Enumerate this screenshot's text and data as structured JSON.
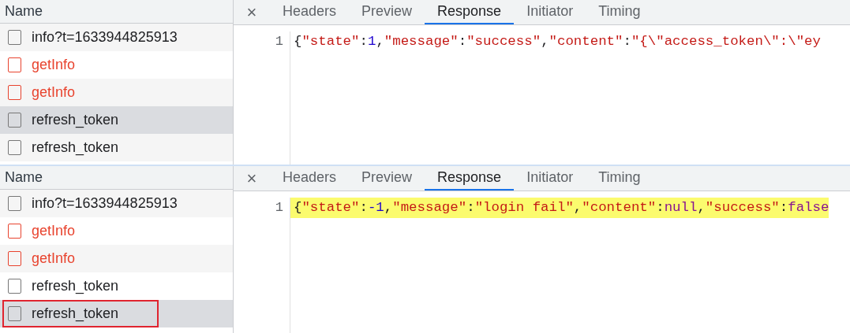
{
  "panels": [
    {
      "requests": {
        "column": "Name",
        "rows": [
          {
            "name": "info?t=1633944825913",
            "kind": "ok",
            "selected": false,
            "outlined": false
          },
          {
            "name": "getInfo",
            "kind": "error",
            "selected": false,
            "outlined": false
          },
          {
            "name": "getInfo",
            "kind": "error",
            "selected": false,
            "outlined": false
          },
          {
            "name": "refresh_token",
            "kind": "ok",
            "selected": true,
            "outlined": false
          },
          {
            "name": "refresh_token",
            "kind": "ok",
            "selected": false,
            "outlined": false
          }
        ]
      },
      "close": "×",
      "tabs": [
        {
          "label": "Headers",
          "selected": false
        },
        {
          "label": "Preview",
          "selected": false
        },
        {
          "label": "Response",
          "selected": true
        },
        {
          "label": "Initiator",
          "selected": false
        },
        {
          "label": "Timing",
          "selected": false
        }
      ],
      "response": {
        "line_number": "1",
        "highlighted": false,
        "tokens": [
          {
            "kind": "punct",
            "text": "{"
          },
          {
            "kind": "string",
            "text": "\"state\""
          },
          {
            "kind": "punct",
            "text": ":"
          },
          {
            "kind": "number",
            "text": "1"
          },
          {
            "kind": "punct",
            "text": ","
          },
          {
            "kind": "string",
            "text": "\"message\""
          },
          {
            "kind": "punct",
            "text": ":"
          },
          {
            "kind": "string",
            "text": "\"success\""
          },
          {
            "kind": "punct",
            "text": ","
          },
          {
            "kind": "string",
            "text": "\"content\""
          },
          {
            "kind": "punct",
            "text": ":"
          },
          {
            "kind": "string",
            "text": "\"{\\\"access_token\\\":\\\"ey"
          }
        ]
      }
    },
    {
      "requests": {
        "column": "Name",
        "rows": [
          {
            "name": "info?t=1633944825913",
            "kind": "ok",
            "selected": false,
            "outlined": false
          },
          {
            "name": "getInfo",
            "kind": "error",
            "selected": false,
            "outlined": false
          },
          {
            "name": "getInfo",
            "kind": "error",
            "selected": false,
            "outlined": false
          },
          {
            "name": "refresh_token",
            "kind": "ok",
            "selected": false,
            "outlined": false
          },
          {
            "name": "refresh_token",
            "kind": "ok",
            "selected": true,
            "outlined": true
          }
        ]
      },
      "close": "×",
      "tabs": [
        {
          "label": "Headers",
          "selected": false
        },
        {
          "label": "Preview",
          "selected": false
        },
        {
          "label": "Response",
          "selected": true
        },
        {
          "label": "Initiator",
          "selected": false
        },
        {
          "label": "Timing",
          "selected": false
        }
      ],
      "response": {
        "line_number": "1",
        "highlighted": true,
        "tokens": [
          {
            "kind": "punct",
            "text": "{"
          },
          {
            "kind": "string",
            "text": "\"state\""
          },
          {
            "kind": "punct",
            "text": ":"
          },
          {
            "kind": "number",
            "text": "-1"
          },
          {
            "kind": "punct",
            "text": ","
          },
          {
            "kind": "string",
            "text": "\"message\""
          },
          {
            "kind": "punct",
            "text": ":"
          },
          {
            "kind": "string",
            "text": "\"login fail\""
          },
          {
            "kind": "punct",
            "text": ","
          },
          {
            "kind": "string",
            "text": "\"content\""
          },
          {
            "kind": "punct",
            "text": ":"
          },
          {
            "kind": "keyword",
            "text": "null"
          },
          {
            "kind": "punct",
            "text": ","
          },
          {
            "kind": "string",
            "text": "\"success\""
          },
          {
            "kind": "punct",
            "text": ":"
          },
          {
            "kind": "keyword",
            "text": "false"
          }
        ]
      }
    }
  ]
}
